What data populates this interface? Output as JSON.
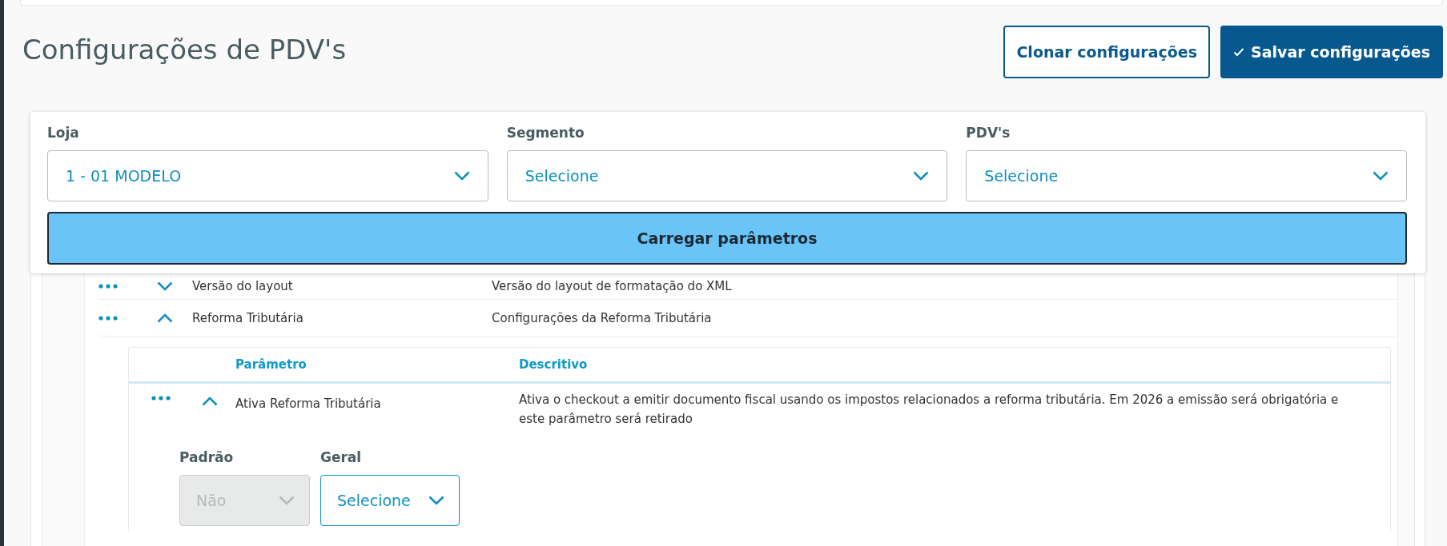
{
  "page_title": "Configurações de PDV's",
  "actions": [
    {
      "label": "Clonar configurações",
      "kind": "outline"
    },
    {
      "label": "Salvar configurações",
      "kind": "primary"
    }
  ],
  "filters": [
    {
      "label": "Loja",
      "value": "1 - 01 MODELO"
    },
    {
      "label": "Segmento",
      "placeholder": "Selecione"
    },
    {
      "label": "PDV's",
      "placeholder": "Selecione"
    }
  ],
  "load_button": "Carregar parâmetros",
  "parameters": [
    {
      "name": "Versão do layout",
      "description": "Versão do layout de formatação do XML",
      "expanded": false
    },
    {
      "name": "Reforma Tributária",
      "description": "Configurações da Reforma Tributária",
      "expanded": true,
      "columns": [
        "Parâmetro",
        "Descritivo"
      ],
      "children": [
        {
          "name": "Ativa Reforma Tributária",
          "description": "Ativa o checkout a emitir documento fiscal usando os impostos relacionados a reforma tributária. Em 2026 a emissão será obrigatória e este parâmetro será retirado",
          "expanded": true,
          "fields": [
            {
              "label": "Padrão",
              "value": "Não",
              "disabled": true
            },
            {
              "label": "Geral",
              "placeholder": "Selecione",
              "disabled": false
            }
          ]
        }
      ]
    }
  ]
}
